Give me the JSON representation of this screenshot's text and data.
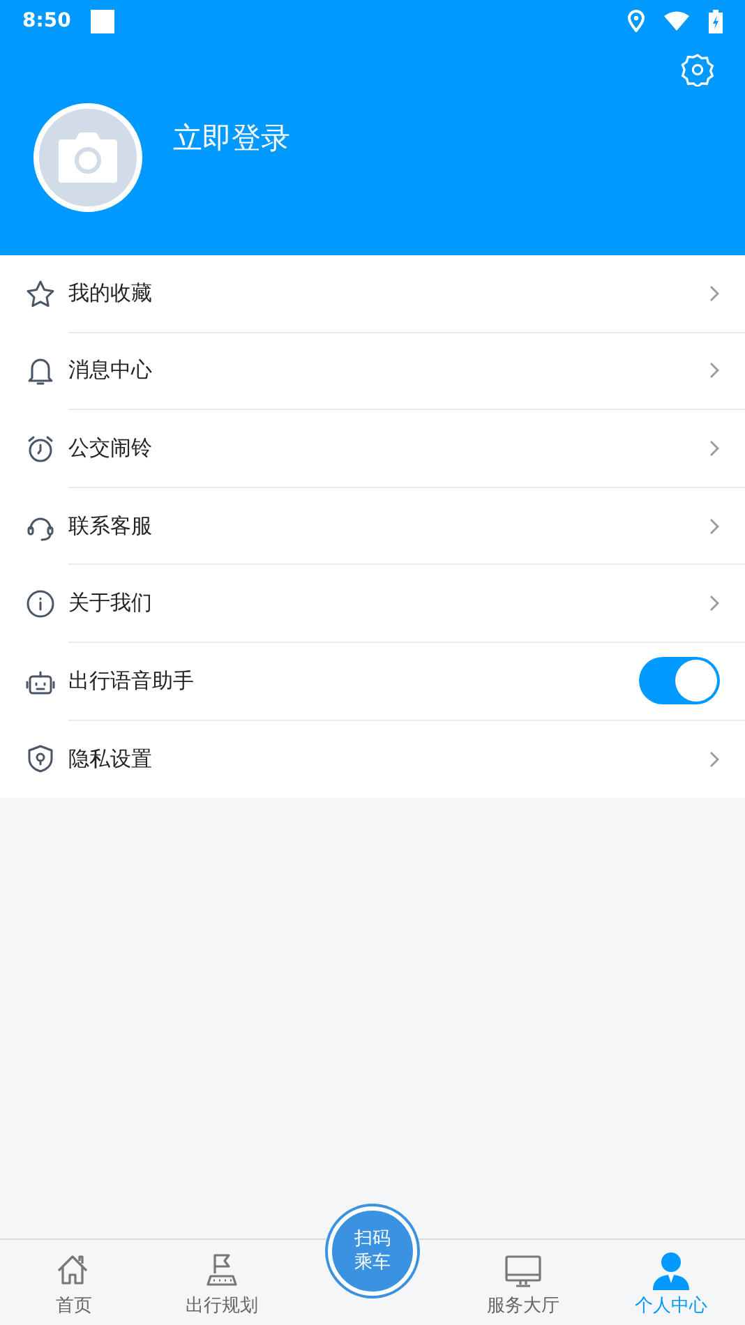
{
  "status_bar": {
    "time": "8:50"
  },
  "profile": {
    "login_label": "立即登录"
  },
  "menu": [
    {
      "kind": "link",
      "label": "我的收藏"
    },
    {
      "kind": "link",
      "label": "消息中心"
    },
    {
      "kind": "link",
      "label": "公交闹铃"
    },
    {
      "kind": "link",
      "label": "联系客服"
    },
    {
      "kind": "link",
      "label": "关于我们"
    },
    {
      "kind": "toggle",
      "label": "出行语音助手",
      "on": true
    },
    {
      "kind": "link",
      "label": "隐私设置"
    }
  ],
  "scan_button": {
    "label": "扫码乘车"
  },
  "tab_bar": [
    {
      "label": "首页",
      "selected": false
    },
    {
      "label": "出行规划",
      "selected": false
    },
    {
      "label": "服务大厅",
      "selected": false
    },
    {
      "label": "个人中心",
      "selected": true
    }
  ]
}
